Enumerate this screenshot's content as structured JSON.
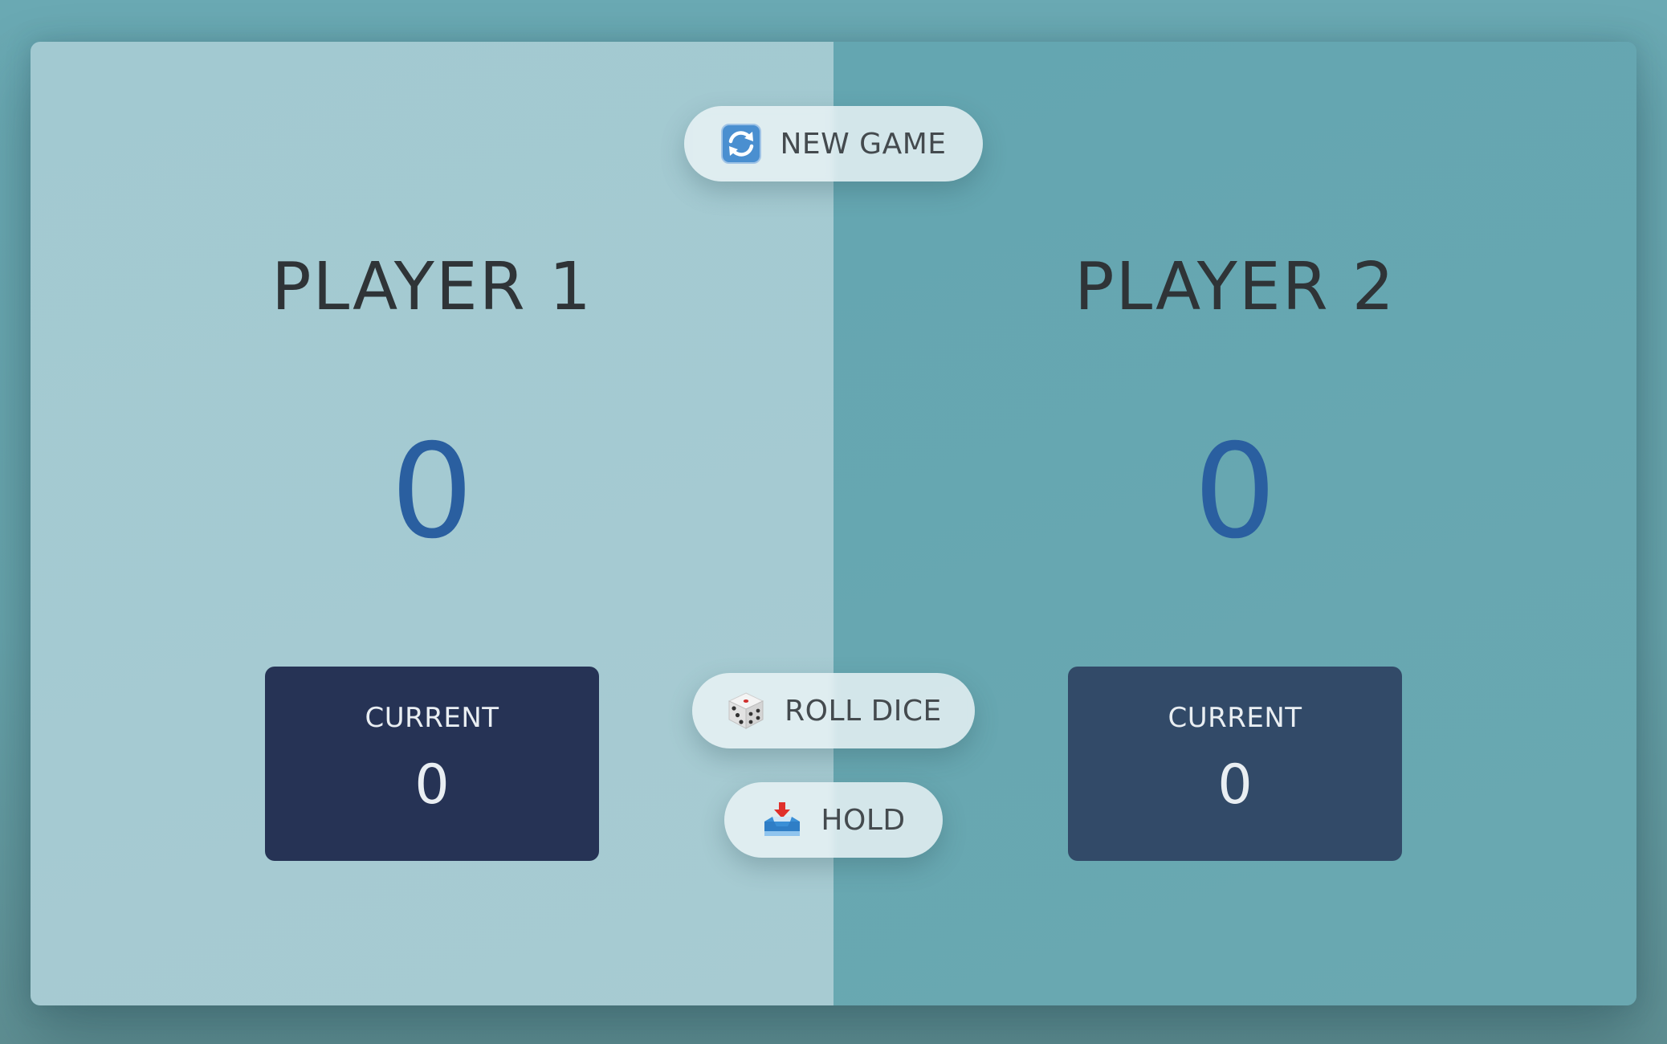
{
  "players": [
    {
      "name": "PLAYER 1",
      "score": "0",
      "current_label": "CURRENT",
      "current_score": "0",
      "active": true
    },
    {
      "name": "PLAYER 2",
      "score": "0",
      "current_label": "CURRENT",
      "current_score": "0",
      "active": false
    }
  ],
  "buttons": {
    "new_game": {
      "label": "NEW GAME",
      "icon": "refresh-icon"
    },
    "roll_dice": {
      "label": "ROLL DICE",
      "icon": "dice-icon"
    },
    "hold": {
      "label": "HOLD",
      "icon": "inbox-tray-icon"
    }
  },
  "colors": {
    "score": "#2a5fa0",
    "active_panel": "#a2c9d1",
    "idle_panel": "#64a6b1",
    "current_active": "#263355",
    "current_idle": "#324a68"
  }
}
